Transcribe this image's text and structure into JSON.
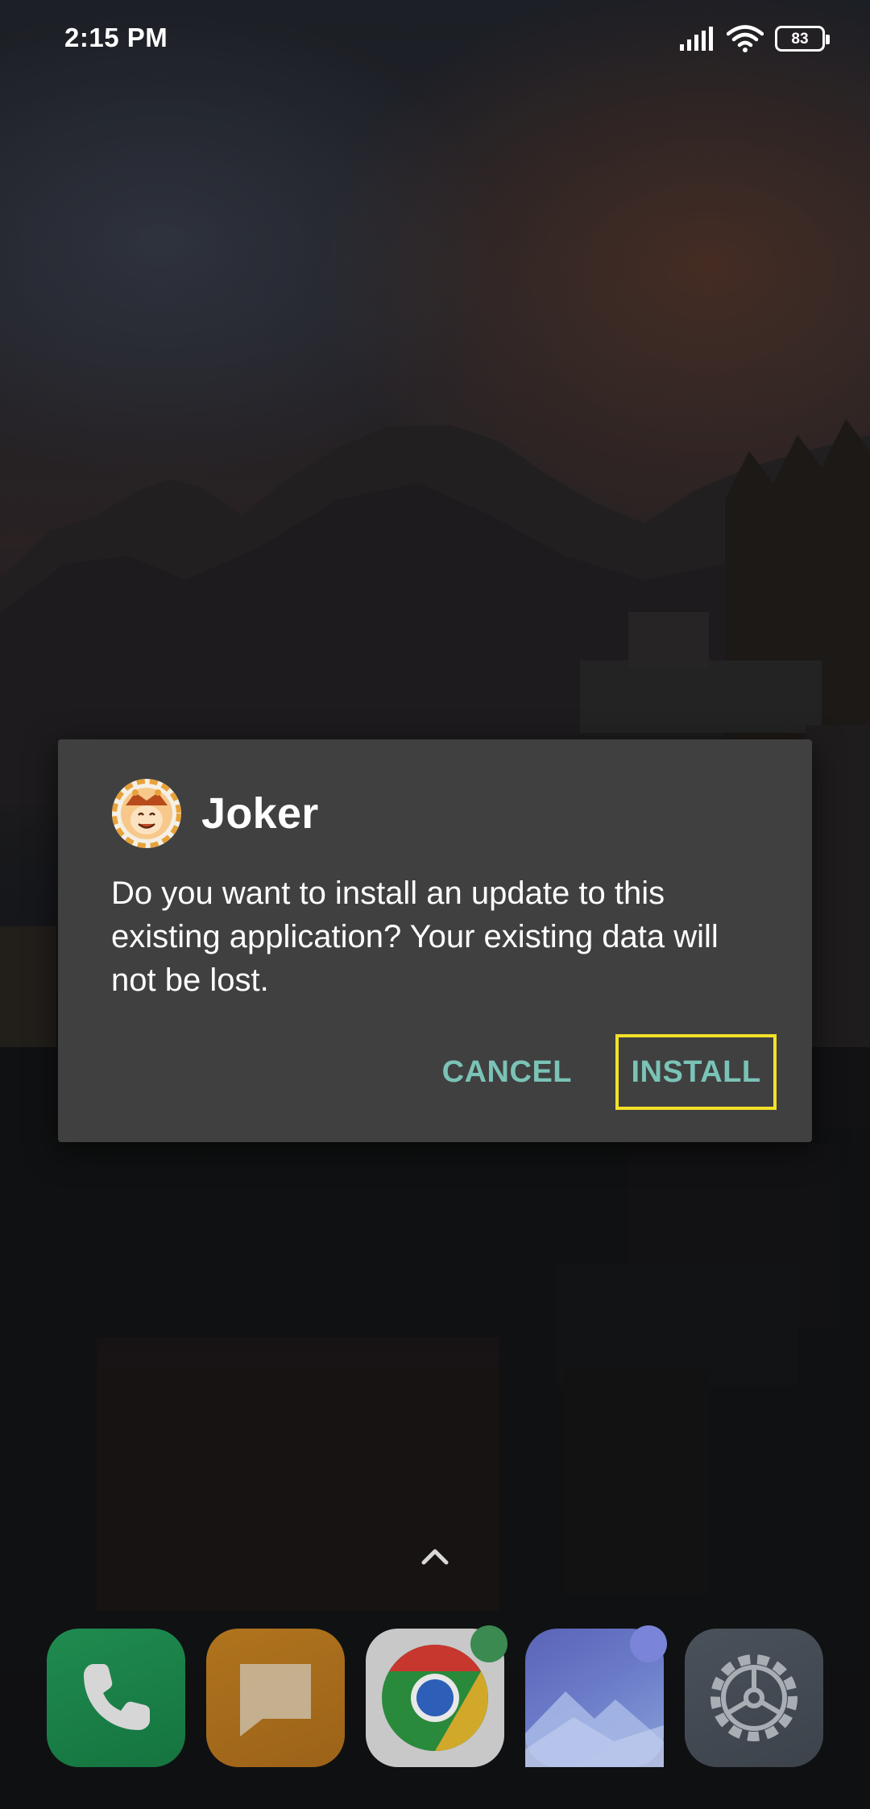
{
  "status_bar": {
    "time": "2:15 PM",
    "battery_level": "83",
    "icons": [
      "signal-icon",
      "wifi-icon",
      "battery-icon"
    ]
  },
  "dialog": {
    "app_name": "Joker",
    "app_icon": "joker-app-icon",
    "message": "Do you want to install an update to this existing application? Your existing data will not be lost.",
    "cancel_label": "CANCEL",
    "install_label": "INSTALL",
    "accent_color": "#7ac3b6",
    "highlight_color": "#f2e12a"
  },
  "home": {
    "swipe_hint_icon": "chevron-up-icon",
    "dock": [
      {
        "name": "phone",
        "icon": "phone-icon"
      },
      {
        "name": "messages",
        "icon": "message-icon"
      },
      {
        "name": "chrome",
        "icon": "chrome-icon"
      },
      {
        "name": "gallery",
        "icon": "gallery-icon"
      },
      {
        "name": "settings",
        "icon": "gear-icon"
      }
    ]
  }
}
